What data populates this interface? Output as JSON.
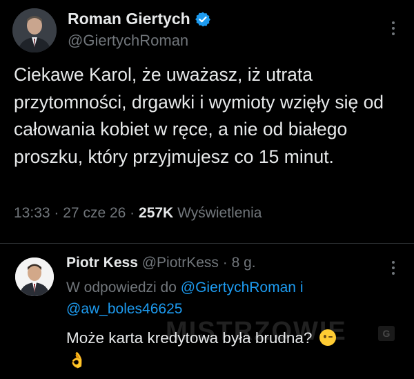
{
  "main_tweet": {
    "author_name": "Roman Giertych",
    "author_handle": "@GiertychRoman",
    "avatar_icon": "person-photo-avatar",
    "verified_icon": "verified-badge-icon",
    "text": "Ciekawe Karol, że uważasz, iż utrata przytomności, drgawki i wymioty wzięły się od całowania kobiet w ręce, a nie od białego proszku, który przyjmujesz co 15 minut.",
    "time": "13:33",
    "date": "27 cze 26",
    "views_count": "257K",
    "views_label": "Wyświetlenia",
    "separator": "·"
  },
  "reply": {
    "author_name": "Piotr Kess",
    "author_handle": "@PiotrKess",
    "age": "8 g.",
    "avatar_icon": "person-photo-avatar",
    "in_reply_prefix": "W odpowiedzi do",
    "mention_1": "@GiertychRoman",
    "mention_join": "i",
    "mention_2": "@aw_boles46625",
    "text": "Może karta kredytowa była brudna?",
    "emoji_1": "winking-face-emoji",
    "emoji_2_char": "👌"
  },
  "watermark": {
    "text": "MISTRZOWIE",
    "badge": "G"
  },
  "colors": {
    "background": "#000000",
    "text_primary": "#e7e9ea",
    "text_secondary": "#71767b",
    "link": "#1d9bf0",
    "divider": "#2f3336"
  }
}
